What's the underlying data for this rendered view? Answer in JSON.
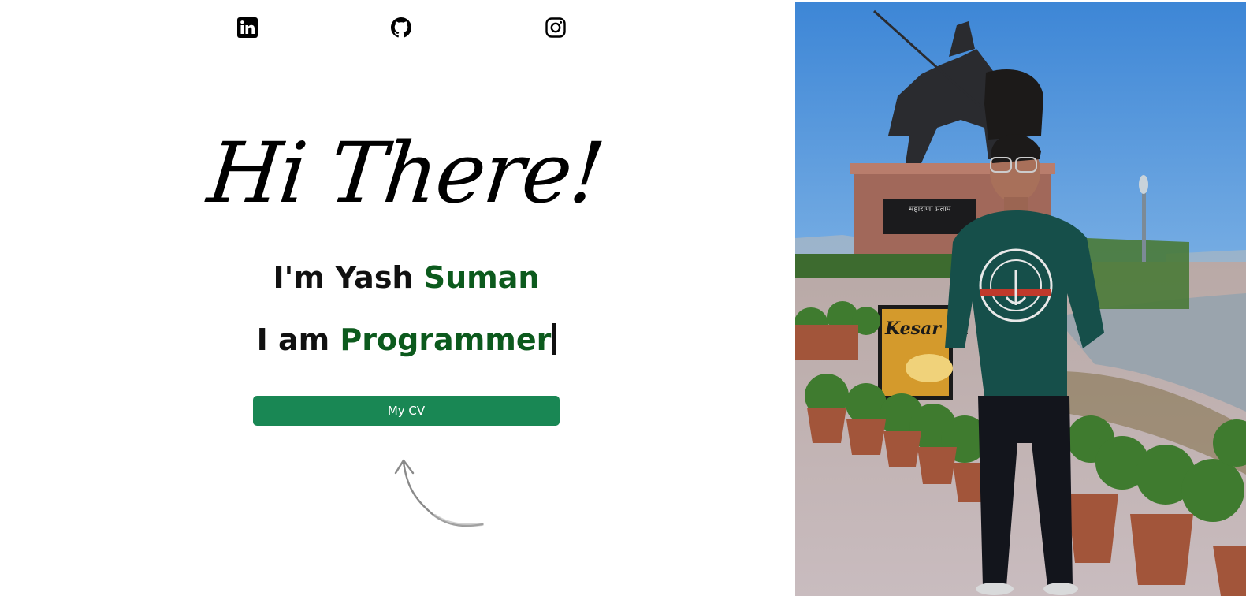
{
  "social": {
    "linkedin_icon": "linkedin-icon",
    "github_icon": "github-icon",
    "instagram_icon": "instagram-icon"
  },
  "hero": {
    "greeting": "Hi There!",
    "intro_prefix": "I'm Yash ",
    "intro_highlight": "Suman",
    "role_prefix": "I am ",
    "role_highlight": "Programmer"
  },
  "cv_button": {
    "label": "My CV"
  },
  "photo": {
    "sign_text": "Kesar Ta",
    "plaque_text": "महाराणा प्रताप"
  },
  "colors": {
    "accent_green": "#0c5a1d",
    "button_green": "#198754"
  }
}
